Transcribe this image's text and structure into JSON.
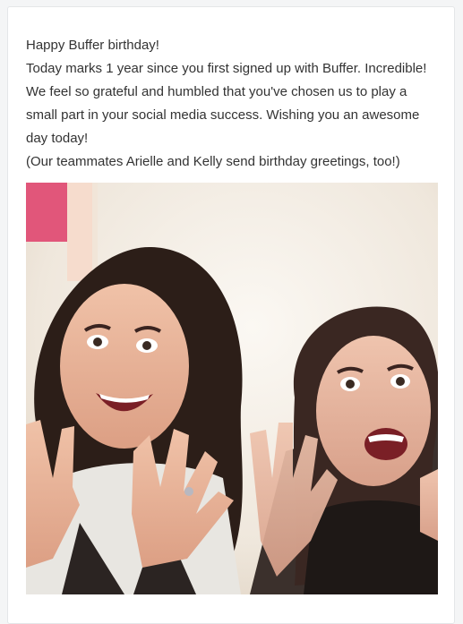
{
  "email": {
    "greeting": "Happy Buffer birthday!",
    "milestone": "Today marks 1 year since you first signed up with Buffer. Incredible!",
    "gratitude": "We feel so grateful and humbled that you've chosen us to play a small part in your social media success. Wishing you an awesome day today!",
    "teammates_note": "(Our teammates Arielle and Kelly send birthday greetings, too!)"
  },
  "photo": {
    "subject": "Arielle and Kelly waving"
  },
  "colors": {
    "background": "#f4f5f6",
    "card": "#ffffff",
    "text": "#333333",
    "border": "#e4e6e8"
  }
}
